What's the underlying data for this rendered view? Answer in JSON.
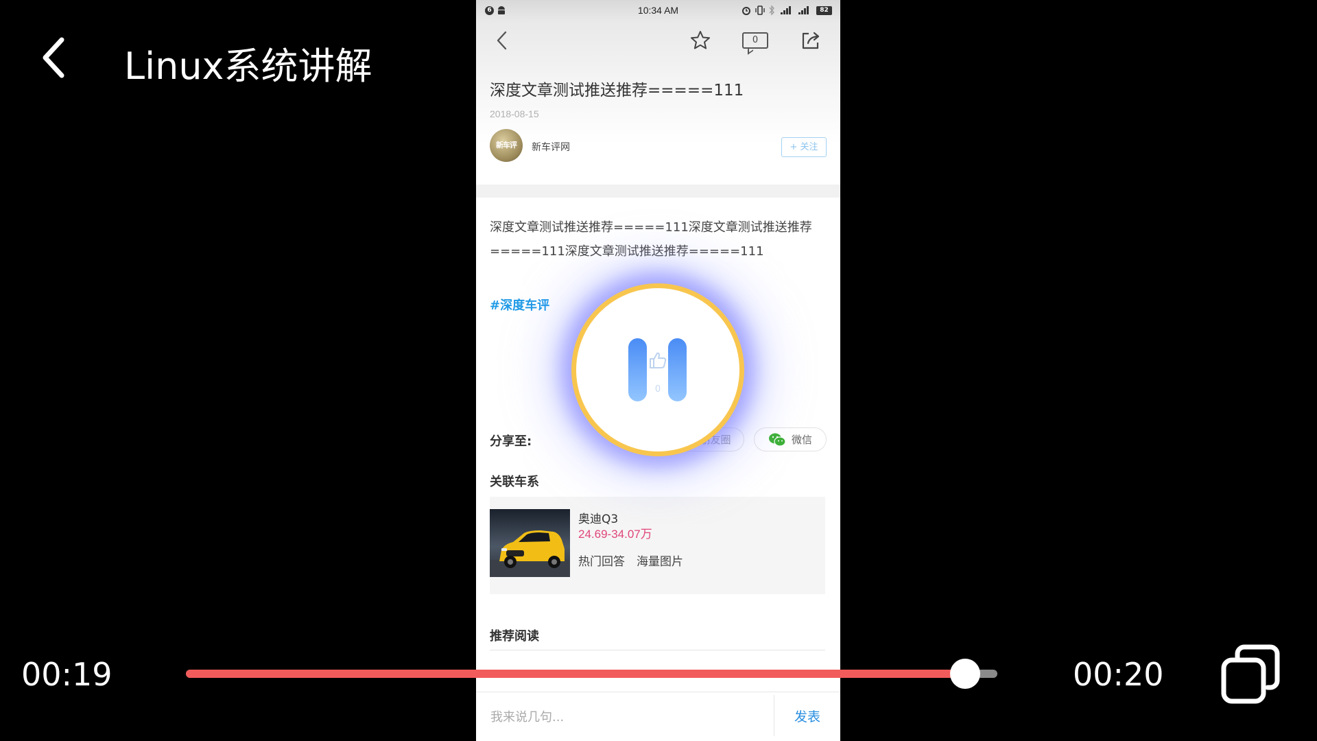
{
  "player": {
    "title": "Linux系统讲解",
    "current_time": "00:19",
    "duration": "00:20",
    "progress": 0.96,
    "accent": "#f25b5b",
    "state": "paused"
  },
  "phone": {
    "status_bar": {
      "left_badge": "6",
      "time": "10:34 AM",
      "battery": "82"
    },
    "nav": {
      "comment_count": "0"
    },
    "article": {
      "title": "深度文章测试推送推荐=====111",
      "date": "2018-08-15",
      "avatar_label": "新车评",
      "author": "新车评网",
      "follow_label": "+ 关注",
      "body": "深度文章测试推送推荐=====111深度文章测试推送推荐=====111深度文章测试推送推荐=====111",
      "tag": "#深度车评",
      "like_count": "0"
    },
    "share": {
      "label": "分享至:",
      "moments": "朋友圈",
      "wechat": "微信"
    },
    "related": {
      "heading": "关联车系",
      "car": {
        "name": "奥迪Q3",
        "price": "24.69-34.07万",
        "links": [
          "热门回答",
          "海量图片"
        ]
      }
    },
    "recommend": {
      "heading": "推荐阅读"
    },
    "comment": {
      "placeholder": "我来说几句...",
      "submit": "发表"
    }
  }
}
